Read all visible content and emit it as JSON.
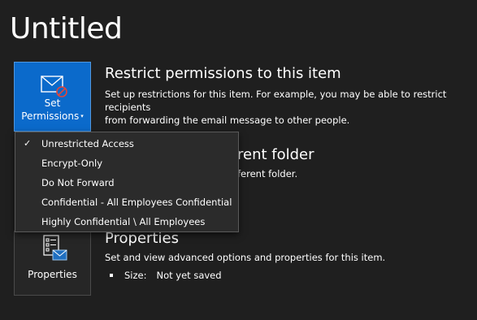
{
  "page": {
    "title": "Untitled"
  },
  "permissions": {
    "button": {
      "line1": "Set",
      "line2": "Permissions",
      "caret": "▾",
      "icon": "envelope-restricted-icon"
    },
    "title": "Restrict permissions to this item",
    "desc_line1": "Set up restrictions for this item. For example, you may be able to restrict recipients",
    "desc_line2": "from forwarding the email message to other people."
  },
  "move": {
    "title_partial": "rent folder",
    "desc_partial": "ferent folder."
  },
  "properties": {
    "button": {
      "label": "Properties",
      "icon": "document-properties-icon"
    },
    "title": "Properties",
    "desc": "Set and view advanced options and properties for this item.",
    "size_label": "Size:",
    "size_value": "Not yet saved"
  },
  "menu": {
    "checkmark": "✓",
    "items": [
      {
        "label": "Unrestricted Access",
        "checked": true
      },
      {
        "label": "Encrypt-Only",
        "checked": false
      },
      {
        "label": "Do Not Forward",
        "checked": false
      },
      {
        "label": "Confidential - All Employees Confidential",
        "checked": false
      },
      {
        "label": "Highly Confidential \\ All Employees",
        "checked": false
      }
    ]
  },
  "colors": {
    "background": "#1f1f1f",
    "accent": "#0b6acb",
    "menu_bg": "#2b2b2b",
    "warning_red": "#e0463c"
  }
}
